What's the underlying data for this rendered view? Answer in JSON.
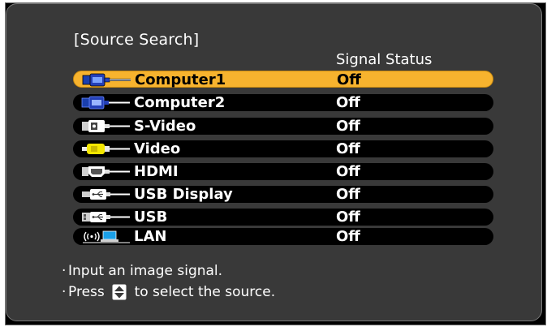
{
  "dialog": {
    "title": "[Source Search]",
    "column_header": "Signal Status"
  },
  "sources": [
    {
      "name": "Computer1",
      "status": "Off",
      "icon": "computer-port-icon",
      "selected": true
    },
    {
      "name": "Computer2",
      "status": "Off",
      "icon": "computer-port-icon",
      "selected": false
    },
    {
      "name": "S-Video",
      "status": "Off",
      "icon": "s-video-plug-icon",
      "selected": false
    },
    {
      "name": "Video",
      "status": "Off",
      "icon": "rca-video-plug-icon",
      "selected": false
    },
    {
      "name": "HDMI",
      "status": "Off",
      "icon": "hdmi-plug-icon",
      "selected": false
    },
    {
      "name": "USB Display",
      "status": "Off",
      "icon": "usb-plug-icon",
      "selected": false
    },
    {
      "name": "USB",
      "status": "Off",
      "icon": "usb-plug-icon",
      "selected": false
    },
    {
      "name": "LAN",
      "status": "Off",
      "icon": "wireless-lan-icon",
      "selected": false
    }
  ],
  "instructions": {
    "line1": "Input an image signal.",
    "line2_prefix": "Press",
    "line2_icon": "up-down-arrow-icon",
    "line2_suffix": "to select the source."
  },
  "colors": {
    "selection": "#f7b32e",
    "panel_background": "#393939",
    "row_background": "#000000",
    "text": "#ffffff"
  }
}
